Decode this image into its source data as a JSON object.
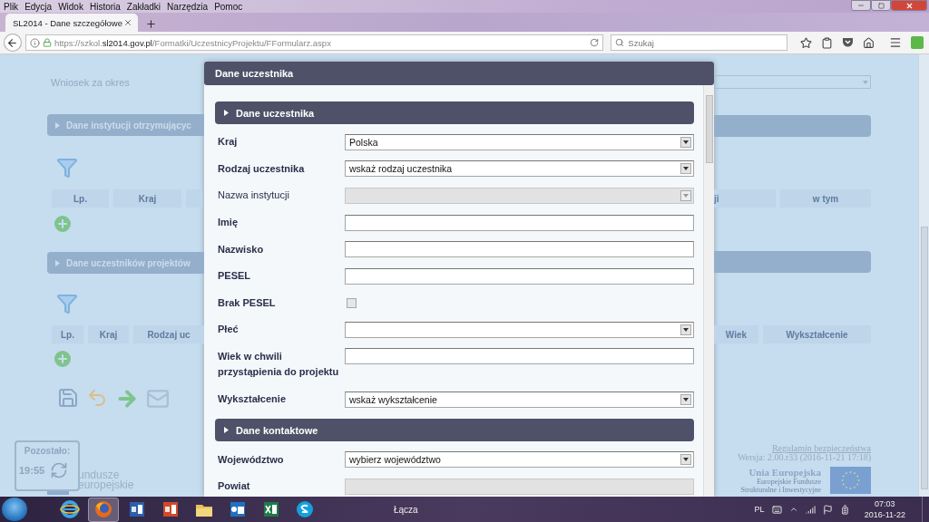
{
  "menu": [
    "Plik",
    "Edycja",
    "Widok",
    "Historia",
    "Zakładki",
    "Narzędzia",
    "Pomoc"
  ],
  "tabs": [
    {
      "label": "SL2014 - Dane szczegółowe",
      "selected": true
    }
  ],
  "address_bar": {
    "url": "https://szkol.**sl2014.gov.pl**/Formatki/UczestnicyProjektu/FFormularz.aspx"
  },
  "search": {
    "placeholder": "Szukaj"
  },
  "page": {
    "period_label": "Wniosek za okres",
    "sections": [
      {
        "title": "Dane instytucji otrzymującyc",
        "left_columns": [
          "Lp.",
          "Kraj"
        ],
        "right_columns": [
          "ji",
          "w tym"
        ]
      },
      {
        "title": "Dane uczestników projektów",
        "left_columns": [
          "Lp.",
          "Kraj",
          "Rodzaj uc"
        ],
        "right_columns": [
          "Wiek",
          "Wykształcenie"
        ]
      }
    ],
    "timer": {
      "label": "Pozostało:",
      "time": "19:55"
    },
    "logo_lines": [
      "undusze",
      "europejskie"
    ],
    "footer": {
      "link": "Regulamin bezpieczeństwa",
      "version": "Wersja: 2.00.r33 (2016-11-21 17:18)",
      "eu_title": "Unia Europejska",
      "eu_lines": [
        "Europejskie Fundusze",
        "Strukturalne i Inwestycyjne"
      ]
    }
  },
  "dialog": {
    "title": "Dane uczestnika",
    "sections": [
      {
        "title": "Dane uczestnika",
        "fields": [
          {
            "label": "Kraj",
            "kind": "select",
            "value": "Polska",
            "required": true,
            "disabled": false
          },
          {
            "label": "Rodzaj uczestnika",
            "kind": "select",
            "value": "wskaż rodzaj uczestnika",
            "required": true,
            "disabled": false
          },
          {
            "label": "Nazwa instytucji",
            "kind": "select",
            "required": false,
            "disabled": true
          },
          {
            "label": "Imię",
            "kind": "text",
            "required": true,
            "disabled": false
          },
          {
            "label": "Nazwisko",
            "kind": "text",
            "required": true,
            "disabled": false
          },
          {
            "label": "PESEL",
            "kind": "text",
            "required": true,
            "disabled": false
          },
          {
            "label": "Brak PESEL",
            "kind": "checkbox",
            "checked": false,
            "required": true,
            "disabled": true
          },
          {
            "label": "Płeć",
            "kind": "select",
            "required": true,
            "disabled": false
          },
          {
            "label": "Wiek w chwili przystąpienia do projektu",
            "kind": "text",
            "required": true,
            "disabled": false
          },
          {
            "label": "Wykształcenie",
            "kind": "select",
            "value": "wskaż wykształcenie",
            "required": true,
            "disabled": false
          }
        ]
      },
      {
        "title": "Dane kontaktowe",
        "fields": [
          {
            "label": "Województwo",
            "kind": "select",
            "value": "wybierz województwo",
            "required": true,
            "disabled": false
          },
          {
            "label": "Powiat",
            "kind": "text",
            "required": true,
            "disabled": true
          }
        ]
      }
    ]
  },
  "taskbar": {
    "apps": [
      {
        "kind": "ie",
        "selected": false
      },
      {
        "kind": "firefox",
        "selected": true
      },
      {
        "kind": "word",
        "selected": false
      },
      {
        "kind": "powerpoint",
        "selected": false
      },
      {
        "kind": "explorer",
        "selected": false
      },
      {
        "kind": "outlook",
        "selected": false
      },
      {
        "kind": "excel",
        "selected": false
      },
      {
        "kind": "skype",
        "selected": false
      }
    ],
    "toolbar_label": "Łącza",
    "language": "PL",
    "time": "07:03",
    "date": "2016-11-22"
  }
}
